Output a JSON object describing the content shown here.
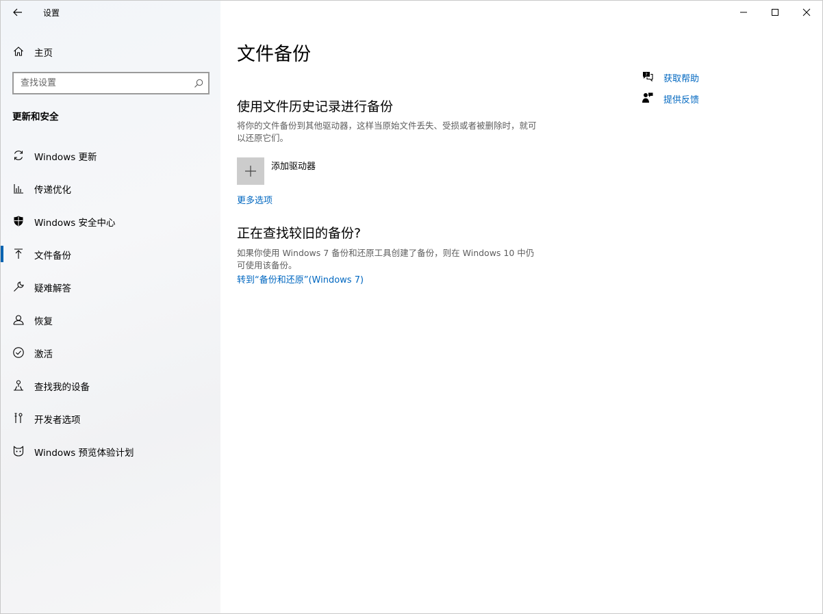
{
  "window": {
    "title": "设置",
    "controls": [
      "minimize",
      "maximize",
      "close"
    ]
  },
  "sidebar": {
    "home_label": "主页",
    "search": {
      "placeholder": "查找设置",
      "value": ""
    },
    "section_heading": "更新和安全",
    "items": [
      {
        "label": "Windows 更新",
        "icon": "sync-icon"
      },
      {
        "label": "传递优化",
        "icon": "delivery-optimization-icon"
      },
      {
        "label": "Windows 安全中心",
        "icon": "shield-icon"
      },
      {
        "label": "文件备份",
        "icon": "backup-arrow-up-icon",
        "selected": true
      },
      {
        "label": "疑难解答",
        "icon": "wrench-icon"
      },
      {
        "label": "恢复",
        "icon": "recovery-icon"
      },
      {
        "label": "激活",
        "icon": "check-circle-icon"
      },
      {
        "label": "查找我的设备",
        "icon": "find-device-icon"
      },
      {
        "label": "开发者选项",
        "icon": "developer-tools-icon"
      },
      {
        "label": "Windows 预览体验计划",
        "icon": "insider-cat-icon"
      }
    ]
  },
  "main": {
    "page_title": "文件备份",
    "file_history": {
      "heading": "使用文件历史记录进行备份",
      "description": "将你的文件备份到其他驱动器，这样当原始文件丢失、受损或者被删除时，就可以还原它们。",
      "add_drive_label": "添加驱动器",
      "more_options_link": "更多选项"
    },
    "older_backup": {
      "heading": "正在查找较旧的备份?",
      "description": "如果你使用 Windows 7 备份和还原工具创建了备份，则在 Windows 10 中仍可使用该备份。",
      "link": "转到“备份和还原”(Windows 7)"
    },
    "help": {
      "get_help": "获取帮助",
      "feedback": "提供反馈"
    }
  },
  "colors": {
    "accent": "#0063b1",
    "link": "#0067c0",
    "add_tile": "#cccccc"
  }
}
